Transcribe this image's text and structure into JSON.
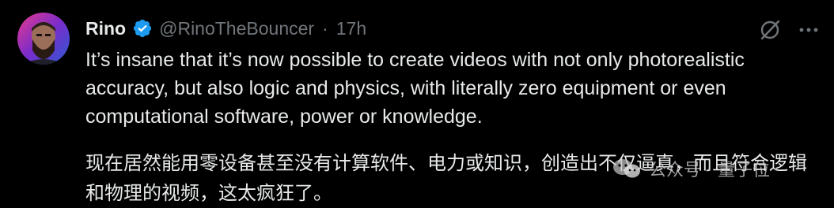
{
  "tweet": {
    "display_name": "Rino",
    "handle": "@RinoTheBouncer",
    "separator": "·",
    "time": "17h",
    "verified": true,
    "text_en": "It’s insane that it’s now possible to create videos with not only photorealistic accuracy, but also logic and physics, with literally zero equipment or even computational software, power or knowledge.",
    "text_zh": "现在居然能用零设备甚至没有计算软件、电力或知识，创造出不仅逼真，而且符合逻辑和物理的视频，这太疯狂了。"
  },
  "watermark": {
    "text": "公众号 · 量子位"
  },
  "icons": {
    "verified": "verified-badge-icon",
    "grok": "grok-icon",
    "more": "more-options-icon",
    "watermark": "wechat-icon"
  },
  "colors": {
    "background": "#000000",
    "text": "#e7e9ea",
    "muted": "#71767b",
    "verified": "#1d9bf0"
  }
}
